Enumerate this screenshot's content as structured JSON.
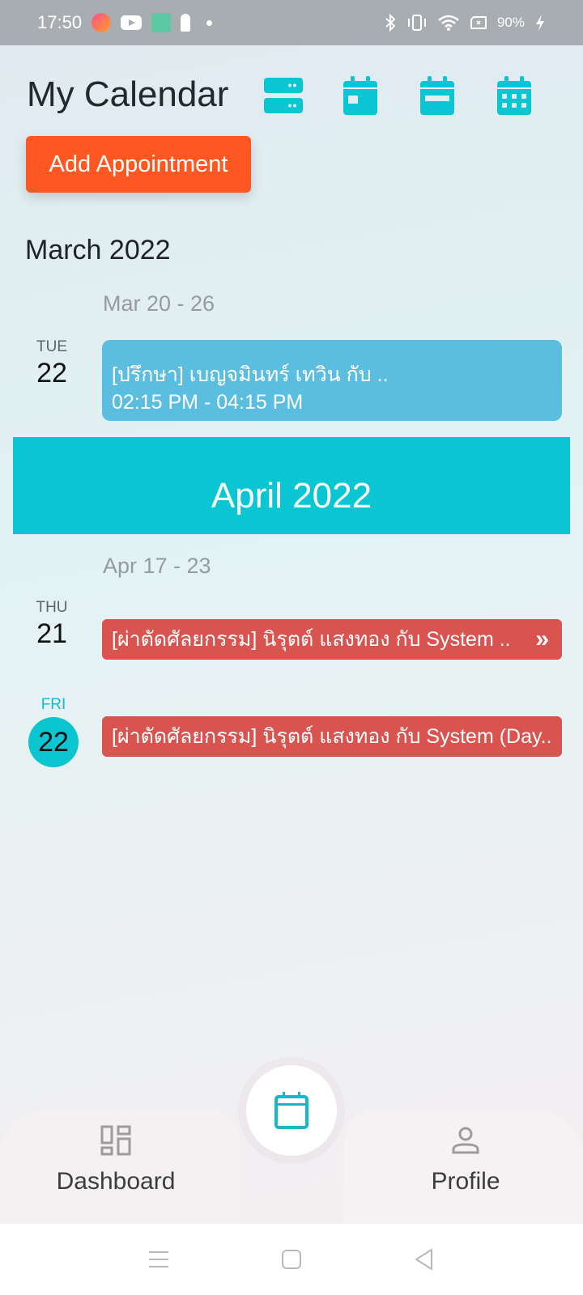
{
  "status_bar": {
    "time": "17:50",
    "battery": "90%",
    "left_icons": [
      "paint-app-icon",
      "youtube-icon",
      "app-green-icon",
      "keyhole-icon",
      "notification-dot"
    ],
    "right_icons": [
      "bluetooth-icon",
      "vibrate-icon",
      "wifi-icon",
      "no-sim-icon",
      "battery-charging-icon"
    ]
  },
  "header": {
    "title": "My Calendar",
    "view_buttons": [
      "agenda-view",
      "day-view",
      "week-view",
      "month-view"
    ]
  },
  "add_button_label": "Add Appointment",
  "colors": {
    "accent": "#0ac6d2",
    "add_button": "#ff5722",
    "event_consult": "#5bbde0",
    "event_surgery": "#d9534f"
  },
  "sections": [
    {
      "month": "March 2022",
      "weeks": [
        {
          "range": "Mar 20 - 26",
          "days": [
            {
              "day_name": "TUE",
              "day_num": "22",
              "today": false,
              "events": [
                {
                  "title": "[ปรึกษา] เบญจมินทร์ เทวิน กับ ..",
                  "time": "02:15 PM - 04:15 PM",
                  "type": "consult"
                }
              ]
            }
          ]
        }
      ]
    },
    {
      "month": "April 2022",
      "weeks": [
        {
          "range": "Apr 17 - 23",
          "days": [
            {
              "day_name": "THU",
              "day_num": "21",
              "today": false,
              "events": [
                {
                  "title": "[ผ่าตัดศัลยกรรม] นิรุตต์ แสงทอง กับ System ..",
                  "continues": "»",
                  "type": "surgery"
                }
              ]
            },
            {
              "day_name": "FRI",
              "day_num": "22",
              "today": true,
              "events": [
                {
                  "title": "[ผ่าตัดศัลยกรรม] นิรุตต์ แสงทอง กับ System (Day..",
                  "type": "surgery"
                }
              ]
            }
          ]
        }
      ]
    }
  ],
  "bottom_nav": {
    "left_label": "Dashboard",
    "right_label": "Profile",
    "center": "calendar"
  }
}
